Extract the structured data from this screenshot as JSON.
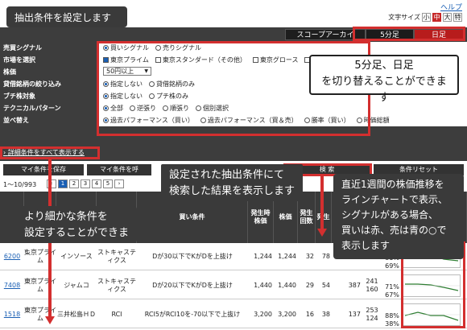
{
  "header": {
    "help": "ヘルプ",
    "font_size_label": "文字サイズ",
    "font_sizes": [
      "小",
      "中",
      "大",
      "特"
    ]
  },
  "tabs": {
    "archive": "スコープアーカイブス",
    "minute": "5分足",
    "daily": "日足"
  },
  "conditions": [
    {
      "label": "売買シグナル",
      "options": [
        {
          "text": "買いシグナル",
          "type": "radio",
          "checked": true
        },
        {
          "text": "売りシグナル",
          "type": "radio",
          "checked": false
        }
      ]
    },
    {
      "label": "市場を選択",
      "options": [
        {
          "text": "東京プライム",
          "type": "check",
          "checked": true
        },
        {
          "text": "東京スタンダード（その他）",
          "type": "check",
          "checked": false
        },
        {
          "text": "東京グロース",
          "type": "check",
          "checked": false
        },
        {
          "text": "その他",
          "type": "check",
          "checked": false
        }
      ]
    },
    {
      "label": "株価",
      "select": "50円以上"
    },
    {
      "label": "貸借銘柄の絞り込み",
      "options": [
        {
          "text": "指定しない",
          "type": "radio",
          "checked": true
        },
        {
          "text": "貸借銘柄のみ",
          "type": "radio",
          "checked": false
        }
      ]
    },
    {
      "label": "ブチ株対象",
      "options": [
        {
          "text": "指定しない",
          "type": "radio",
          "checked": true
        },
        {
          "text": "プチ株のみ",
          "type": "radio",
          "checked": false
        }
      ]
    },
    {
      "label": "テクニカルパターン",
      "options": [
        {
          "text": "全部",
          "type": "radio",
          "checked": true
        },
        {
          "text": "逆張り",
          "type": "radio",
          "checked": false
        },
        {
          "text": "順張り",
          "type": "radio",
          "checked": false
        },
        {
          "text": "個別選択",
          "type": "radio",
          "checked": false
        }
      ]
    },
    {
      "label": "並べ替え",
      "options": [
        {
          "text": "過去パフォーマンス（買い）",
          "type": "radio",
          "checked": true
        },
        {
          "text": "過去パフォーマンス（買＆売）",
          "type": "radio",
          "checked": false
        },
        {
          "text": "勝率（買い）",
          "type": "radio",
          "checked": false
        },
        {
          "text": "時価総額",
          "type": "radio",
          "checked": false
        }
      ]
    }
  ],
  "detail_link": "詳細条件をすべて表示する",
  "actions": {
    "save": "マイ条件を保存",
    "load": "マイ条件を呼",
    "search": "検 索",
    "reset": "条件リセット"
  },
  "pager": {
    "count": "1〜10/993",
    "pages": [
      "2",
      "3",
      "4",
      "5"
    ]
  },
  "table": {
    "headers": [
      "",
      "",
      "",
      "",
      "買い条件",
      "発生時株価",
      "株価",
      "発生回数",
      "発生",
      "",
      "",
      ""
    ],
    "rows": [
      {
        "code": "6200",
        "market": "東京プライム",
        "name": "インソース",
        "tech": "ストキャスティクス",
        "cond": "Dが30以下でKがDを上抜け",
        "p1": "1,244",
        "p2": "1,244",
        "n1": "32",
        "n2": "78",
        "v": "",
        "pct1": "81%",
        "pct2": "69%"
      },
      {
        "code": "7408",
        "market": "東京プライム",
        "name": "ジャムコ",
        "tech": "ストキャスティクス",
        "cond": "Dが20以下でKがDを上抜け",
        "p1": "1,440",
        "p2": "1,440",
        "n1": "29",
        "n2": "54",
        "v": "387",
        "v2": "241 160",
        "pct1": "71%",
        "pct2": "67%"
      },
      {
        "code": "1518",
        "market": "東京プライム",
        "name": "三井松島ＨＤ",
        "tech": "RCI",
        "cond": "RCI5がRCI10を-70以下で上抜け",
        "p1": "3,200",
        "p2": "3,200",
        "n1": "16",
        "n2": "38",
        "v": "137",
        "v2": "253 124",
        "pct1": "88%",
        "pct2": "38%"
      }
    ]
  },
  "callouts": {
    "top": "抽出条件を設定します",
    "tabs": "5分足、日足\nを切り替えることができます",
    "results": "設定された抽出条件にて\n検索した結果を表示します",
    "detail": "より細かな条件を\n設定することができます",
    "chart": "直近1週間の株価推移を\nラインチャートで表示、\nシグナルがある場合、\n買いは赤、売は青の○で\n表示します"
  },
  "colors": {
    "accent_red": "#d32f2f",
    "panel_dark": "#3d3d3d",
    "link_blue": "#1a5fb4"
  }
}
